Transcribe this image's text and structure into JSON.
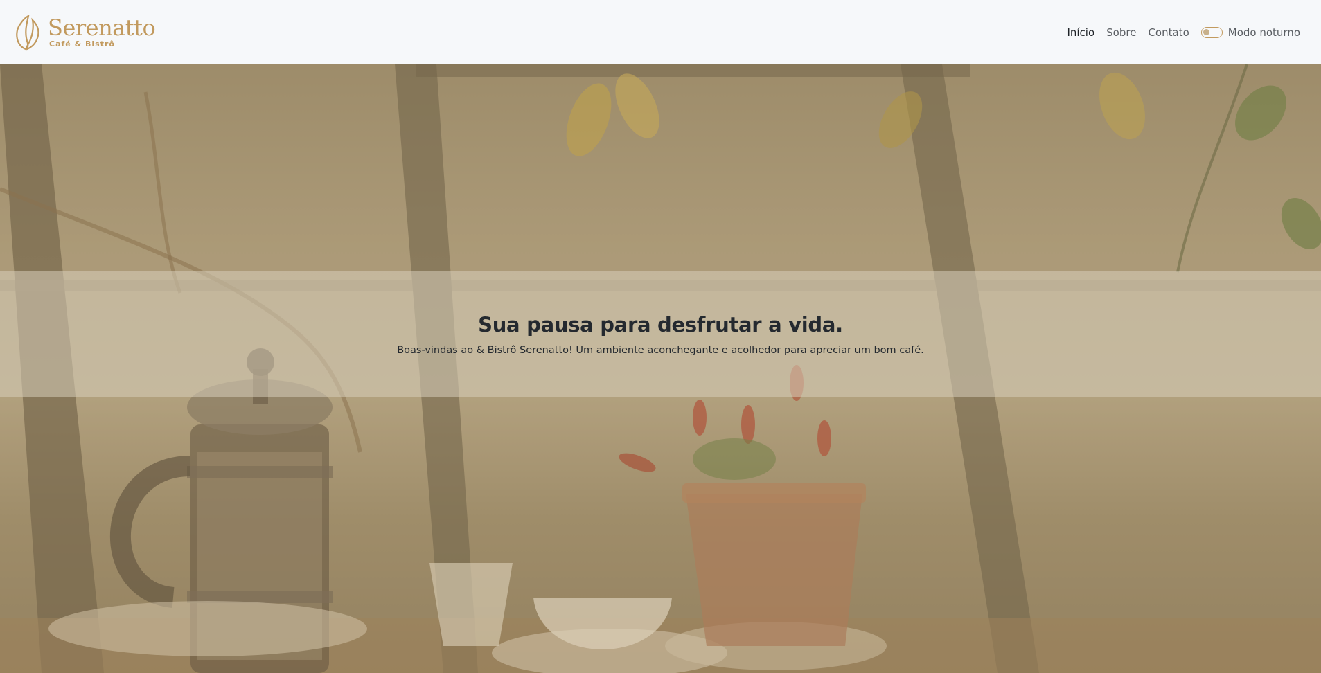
{
  "brand": {
    "name": "Serenatto",
    "subtitle": "Café & Bistrô",
    "color": "#c29a5e",
    "icon": "coffee-bean-leaf-icon"
  },
  "nav": {
    "items": [
      {
        "label": "Início",
        "active": true
      },
      {
        "label": "Sobre",
        "active": false
      },
      {
        "label": "Contato",
        "active": false
      }
    ],
    "night_mode": {
      "label": "Modo noturno",
      "enabled": false
    }
  },
  "hero": {
    "title": "Sua pausa para desfrutar a vida.",
    "subtitle": "Boas-vindas ao & Bistrô Serenatto! Um ambiente aconchegante e acolhedor para apreciar um bom café.",
    "image": "cafe-table-french-press-plant-photo"
  }
}
